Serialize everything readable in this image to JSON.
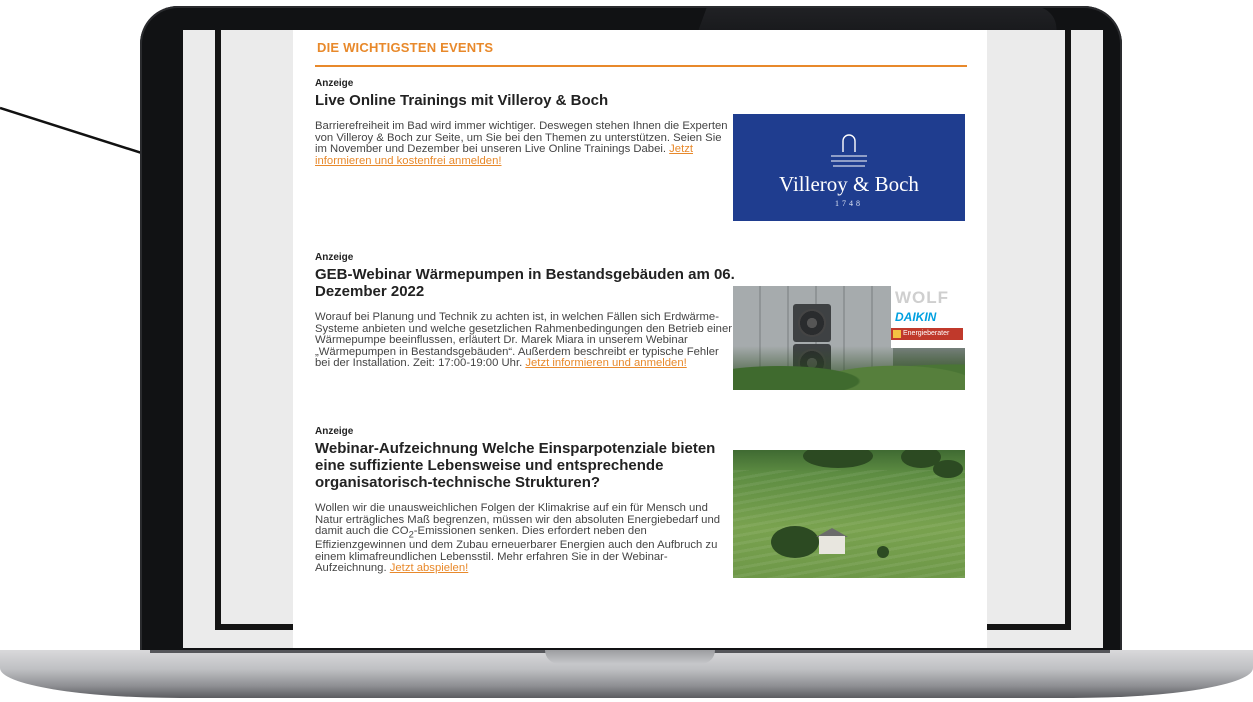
{
  "newsletter": {
    "section_title": "DIE WICHTIGSTEN EVENTS",
    "articles": [
      {
        "ad_label": "Anzeige",
        "headline": "Live Online Trainings mit Villeroy & Boch",
        "body": "Barrierefreiheit im Bad wird immer wichtiger. Deswegen stehen Ihnen die Experten von Villeroy & Boch zur Seite, um Sie bei den Themen zu unterstützen. Seien Sie im November und Dezember bei unseren Live Online Trainings Dabei. ",
        "cta": "Jetzt informieren und kostenfrei anmelden!",
        "image": {
          "brand": "Villeroy & Boch",
          "year": "1748",
          "bg_color": "#1f3d8f"
        }
      },
      {
        "ad_label": "Anzeige",
        "headline": "GEB-Webinar Wärmepumpen in Bestandsgebäuden am 06. Dezember 2022",
        "body": "Worauf bei Planung und Technik zu achten ist, in welchen Fällen sich Erdwärme-Systeme anbieten und welche gesetzlichen Rahmenbedingungen den Betrieb einer Wärmepumpe beeinflussen, erläutert Dr. Marek Miara in unserem Webinar „Wärmepumpen in Bestandsgebäuden“. Außerdem beschreibt er typische Fehler bei der Installation. Zeit: 17:00-19:00 Uhr. ",
        "cta": "Jetzt informieren und anmelden!",
        "image": {
          "logo_wolf": "WOLF",
          "logo_daikin": "DAIKIN",
          "logo_energie": "Energieberater"
        }
      },
      {
        "ad_label": "Anzeige",
        "headline": "Webinar-Aufzeichnung Welche Einsparpotenziale bieten eine suffiziente Lebensweise und entsprechende organisatorisch-technische Strukturen?",
        "body_part1": "Wollen wir die unausweichlichen Folgen der Klimakrise auf ein für Mensch und Natur erträgliches Maß begrenzen, müssen wir den absoluten Energiebedarf und damit auch die CO",
        "body_sub": "2",
        "body_part2": "-Emissionen senken. Dies erfordert neben den Effizienzgewinnen und dem Zubau erneuerbarer Energien auch den Aufbruch zu einem klimafreundlichen Lebensstil. Mehr erfahren Sie in der Webinar-Aufzeichnung. ",
        "cta": "Jetzt abspielen!"
      }
    ]
  },
  "colors": {
    "accent": "#e8892b",
    "text": "#333333",
    "vb_blue": "#1f3d8f",
    "laptop_bezel": "#111214"
  }
}
